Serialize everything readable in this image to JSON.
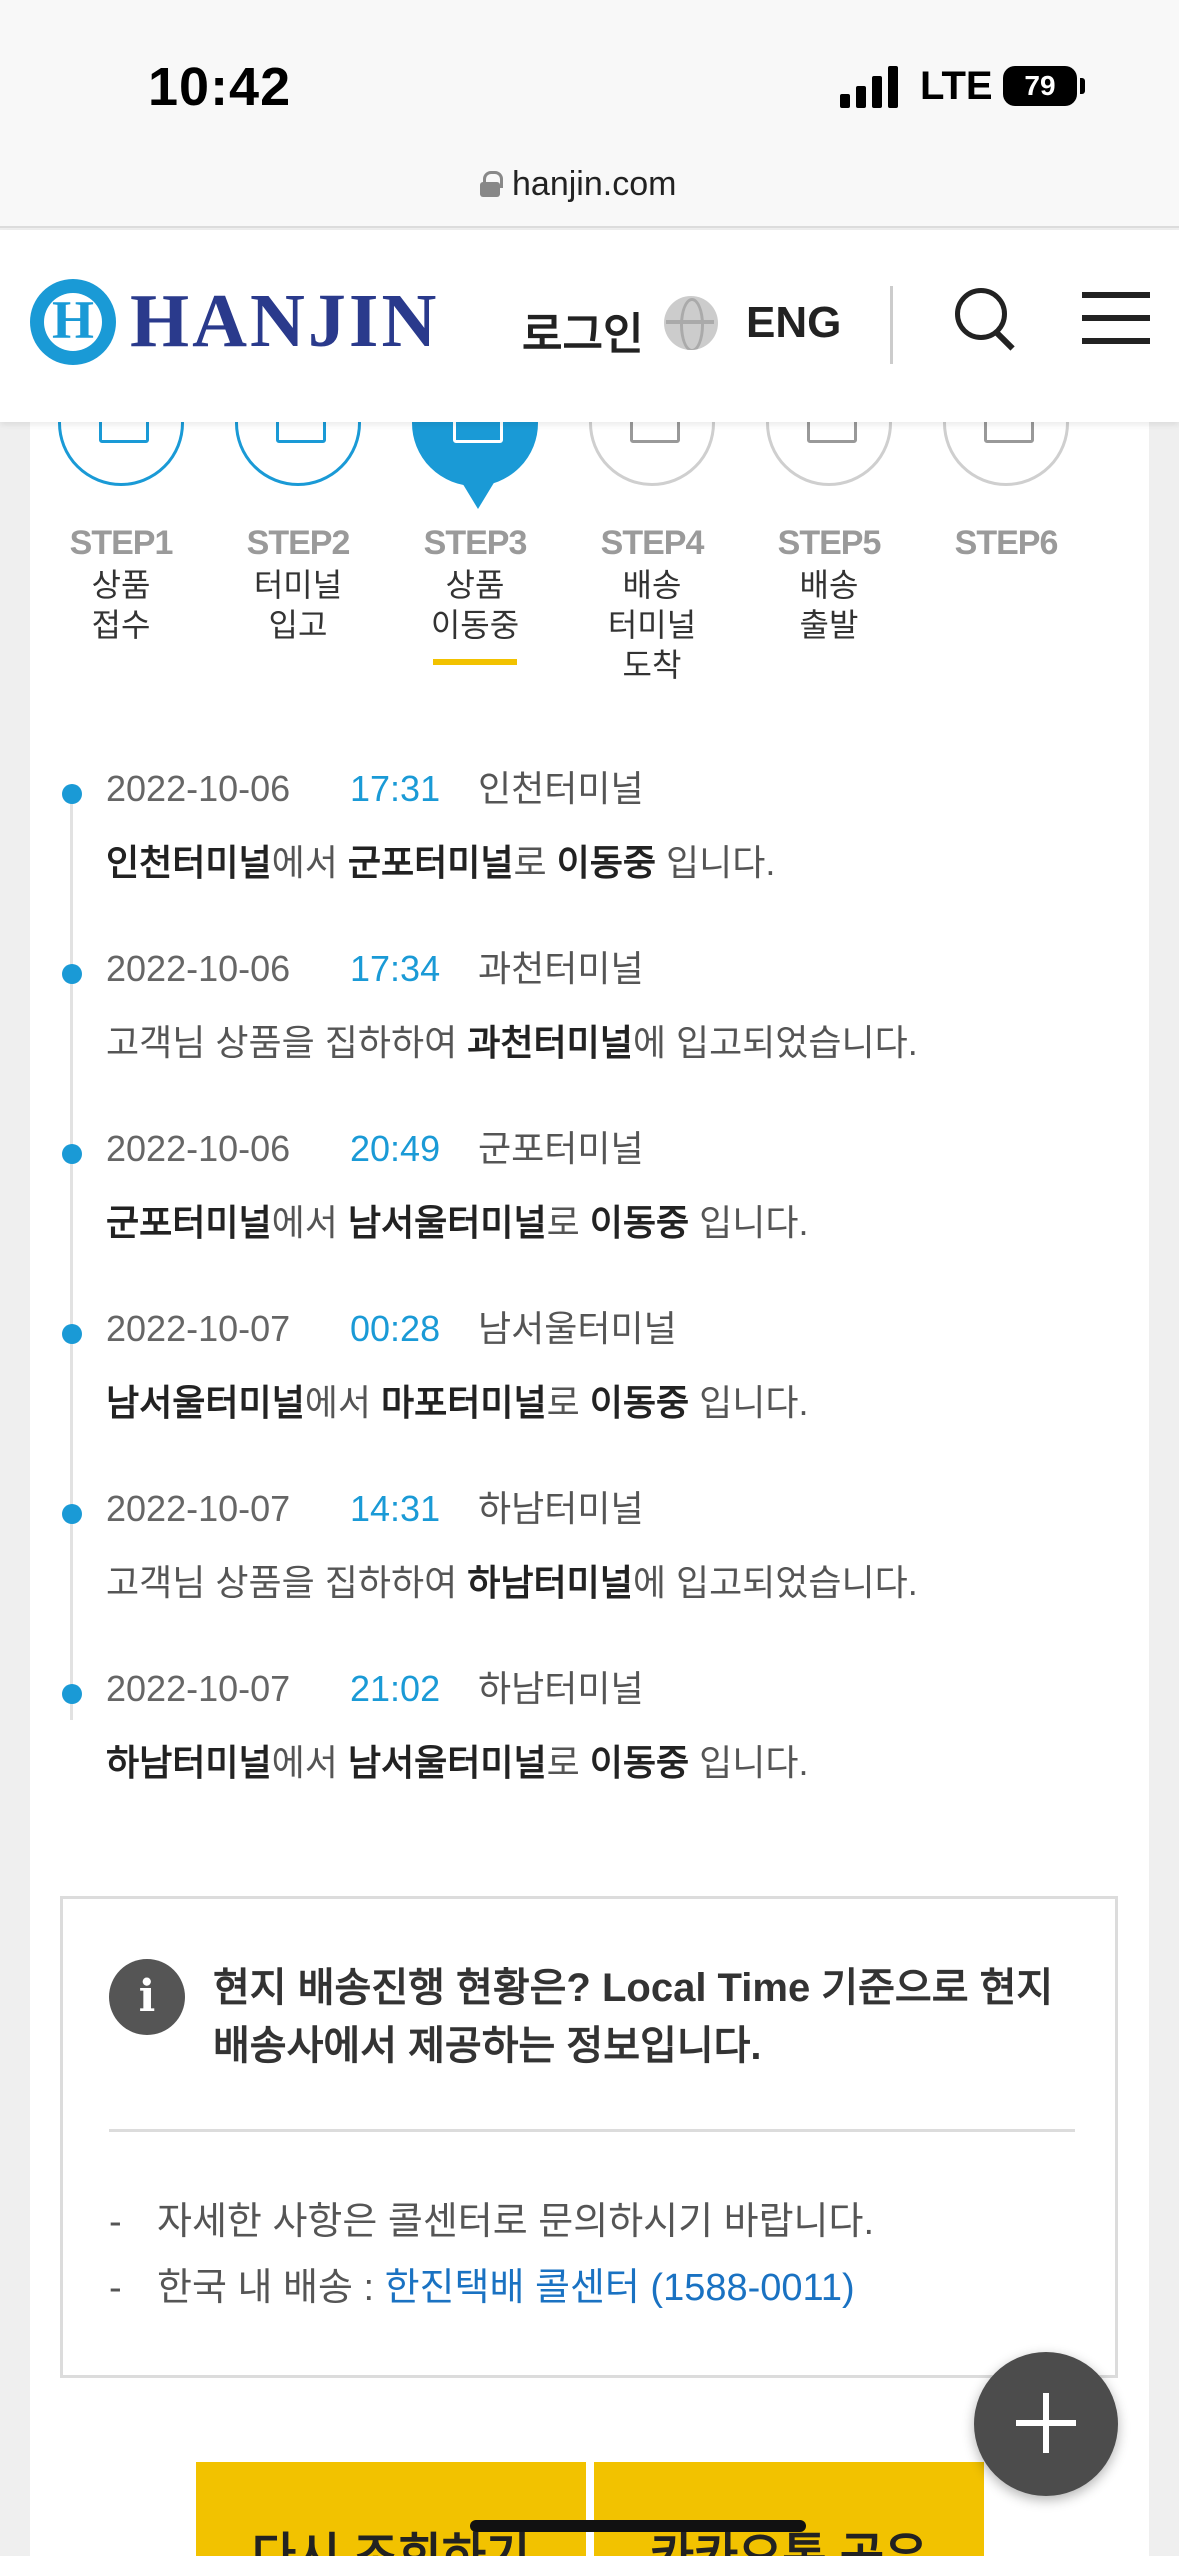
{
  "status_bar": {
    "time": "10:42",
    "network": "LTE",
    "battery": "79"
  },
  "browser": {
    "url": "hanjin.com"
  },
  "header": {
    "logo_text": "HANJIN",
    "login_label": "로그인",
    "language_label": "ENG"
  },
  "steps": [
    {
      "num": "STEP1",
      "label": "상품\n접수",
      "state": "done"
    },
    {
      "num": "STEP2",
      "label": "터미널\n입고",
      "state": "done"
    },
    {
      "num": "STEP3",
      "label": "상품\n이동중",
      "state": "active"
    },
    {
      "num": "STEP4",
      "label": "배송\n터미널\n도착",
      "state": "todo"
    },
    {
      "num": "STEP5",
      "label": "배송\n출발",
      "state": "todo"
    },
    {
      "num": "STEP6",
      "label": "",
      "state": "todo"
    }
  ],
  "timeline": [
    {
      "date": "2022-10-06",
      "time": "17:31",
      "place": "인천터미널",
      "parts": [
        [
          "인천터미널",
          true
        ],
        [
          "에서 ",
          false
        ],
        [
          "군포터미널",
          true
        ],
        [
          "로 ",
          false
        ],
        [
          "이동중",
          true
        ],
        [
          " 입니다.",
          false
        ]
      ]
    },
    {
      "date": "2022-10-06",
      "time": "17:34",
      "place": "과천터미널",
      "parts": [
        [
          "고객님 상품을 집하하여 ",
          false
        ],
        [
          "과천터미널",
          true
        ],
        [
          "에 입고되었습니다.",
          false
        ]
      ]
    },
    {
      "date": "2022-10-06",
      "time": "20:49",
      "place": "군포터미널",
      "parts": [
        [
          "군포터미널",
          true
        ],
        [
          "에서 ",
          false
        ],
        [
          "남서울터미널",
          true
        ],
        [
          "로 ",
          false
        ],
        [
          "이동중",
          true
        ],
        [
          " 입니다.",
          false
        ]
      ]
    },
    {
      "date": "2022-10-07",
      "time": "00:28",
      "place": "남서울터미널",
      "parts": [
        [
          "남서울터미널",
          true
        ],
        [
          "에서 ",
          false
        ],
        [
          "마포터미널",
          true
        ],
        [
          "로 ",
          false
        ],
        [
          "이동중",
          true
        ],
        [
          " 입니다.",
          false
        ]
      ]
    },
    {
      "date": "2022-10-07",
      "time": "14:31",
      "place": "하남터미널",
      "parts": [
        [
          "고객님 상품을 집하하여 ",
          false
        ],
        [
          "하남터미널",
          true
        ],
        [
          "에 입고되었습니다.",
          false
        ]
      ]
    },
    {
      "date": "2022-10-07",
      "time": "21:02",
      "place": "하남터미널",
      "parts": [
        [
          "하남터미널",
          true
        ],
        [
          "에서 ",
          false
        ],
        [
          "남서울터미널",
          true
        ],
        [
          "로 ",
          false
        ],
        [
          "이동중",
          true
        ],
        [
          " 입니다.",
          false
        ]
      ]
    }
  ],
  "info": {
    "title": "현지 배송진행 현황은? Local Time 기준으로 현지 배송사에서 제공하는 정보입니다.",
    "items": [
      {
        "dash": "-",
        "text": "자세한 사항은 콜센터로 문의하시기 바랍니다.",
        "link": ""
      },
      {
        "dash": "-",
        "text": "한국 내 배송 : ",
        "link": "한진택배 콜센터 (1588-0011)"
      }
    ]
  },
  "buttons": {
    "retry": "다시 조회하기",
    "kakao": "카카오톡 공유"
  },
  "colors": {
    "accent": "#1a9ad6",
    "brand_navy": "#2a3a8c",
    "button_yellow": "#f2c200",
    "link_blue": "#1a72c2"
  }
}
